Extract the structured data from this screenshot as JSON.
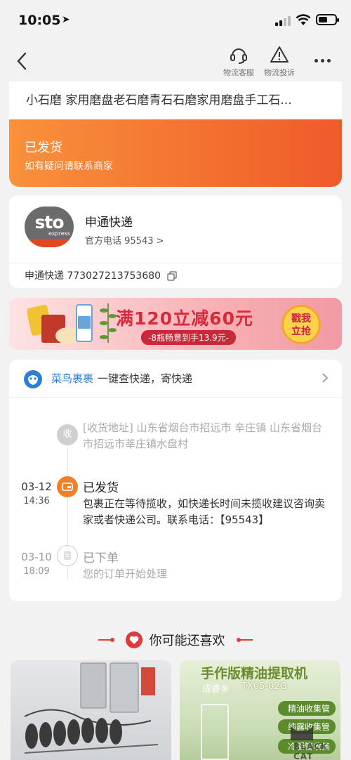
{
  "status_bar": {
    "time": "10:05"
  },
  "nav": {
    "customer_service_label": "物流客服",
    "complaint_label": "物流投诉"
  },
  "order": {
    "product_title": "小石磨 家用磨盘老石磨青石石磨家用磨盘手工石...",
    "status": "已发货",
    "status_hint": "如有疑问请联系商家"
  },
  "courier": {
    "logo_text": "sto",
    "logo_sub": "express",
    "name": "申通快递",
    "phone": "官方电话 95543 >",
    "tracking": "申通快递 773027213753680"
  },
  "banner": {
    "headline": "满120立减60元",
    "pill": "-8瓶畅意到手13.9元-",
    "button_line1": "戳我",
    "button_line2": "立抢"
  },
  "tracking_panel": {
    "brand": "菜鸟裹裹",
    "slogan": "一键查快递，寄快递",
    "events": [
      {
        "icon_label": "收",
        "title": "",
        "desc": "[收货地址] 山东省烟台市招远市  辛庄镇  山东省烟台市招远市莘庄镇水盘村",
        "date": "",
        "time": ""
      },
      {
        "icon_label": "",
        "title": "已发货",
        "desc": "包裹正在等待揽收，如快递长时间未揽收建议咨询卖家或者快递公司。联系电话：【95543】",
        "date": "03-12",
        "time": "14:36"
      },
      {
        "icon_label": "",
        "title": "已下单",
        "desc": "您的订单开始处理",
        "date": "03-10",
        "time": "18:09"
      }
    ]
  },
  "recommend": {
    "header": "你可能还喜欢",
    "products": [
      {
        "image": "tools-photo"
      },
      {
        "headline": "手作版精油提取机",
        "brand": "成睿®",
        "model": "TX05-02G",
        "tags": [
          "精油收集管",
          "纯露收集管",
          "冷凝管收集"
        ]
      }
    ]
  },
  "watermark": {
    "text": "BLACK CAT"
  },
  "colors": {
    "accent_orange": "#ef5a2a",
    "brand_blue": "#2c7fd9",
    "banner_red": "#d62b3a"
  }
}
